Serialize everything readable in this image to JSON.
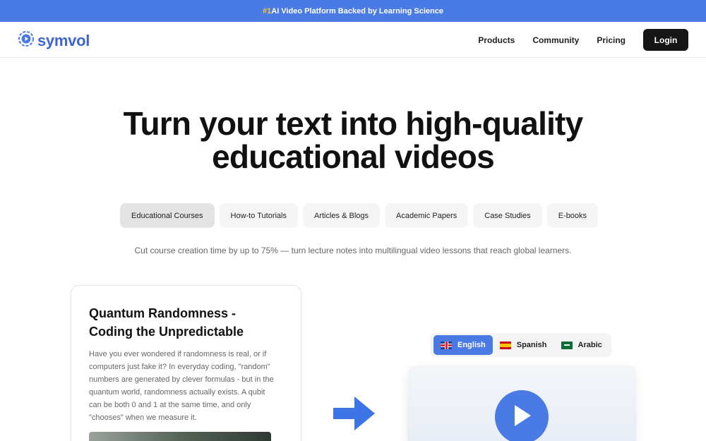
{
  "banner": {
    "highlight": "#1",
    "text": " AI Video Platform Backed by Learning Science"
  },
  "header": {
    "logo_text": "symvol",
    "nav": [
      "Products",
      "Community",
      "Pricing"
    ],
    "login_label": "Login"
  },
  "hero": {
    "title_line1": "Turn your text into high-quality",
    "title_line2": "educational videos"
  },
  "tabs": [
    {
      "label": "Educational Courses",
      "active": true
    },
    {
      "label": "How-to Tutorials",
      "active": false
    },
    {
      "label": "Articles & Blogs",
      "active": false
    },
    {
      "label": "Academic Papers",
      "active": false
    },
    {
      "label": "Case Studies",
      "active": false
    },
    {
      "label": "E-books",
      "active": false
    }
  ],
  "subtitle": "Cut course creation time by up to 75% — turn lecture notes into multilingual video lessons that reach global learners.",
  "example": {
    "title": "Quantum Randomness - Coding the Unpredictable",
    "body": "Have you ever wondered if randomness is real, or if computers just fake it? In everyday coding, \"random\" numbers are generated by clever formulas - but in the quantum world, randomness actually exists. A qubit can be both 0 and 1 at the same time, and only \"chooses\" when we measure it."
  },
  "languages": [
    {
      "label": "English",
      "flag": "flag-uk",
      "active": true
    },
    {
      "label": "Spanish",
      "flag": "flag-es",
      "active": false
    },
    {
      "label": "Arabic",
      "flag": "flag-sa",
      "active": false
    }
  ],
  "colors": {
    "accent": "#4a7ae4",
    "banner_highlight": "#f5c542",
    "dark_button": "#151515"
  },
  "icons": {
    "logo": "symvol-logo-icon",
    "arrow": "arrow-right-icon",
    "play": "play-icon"
  }
}
